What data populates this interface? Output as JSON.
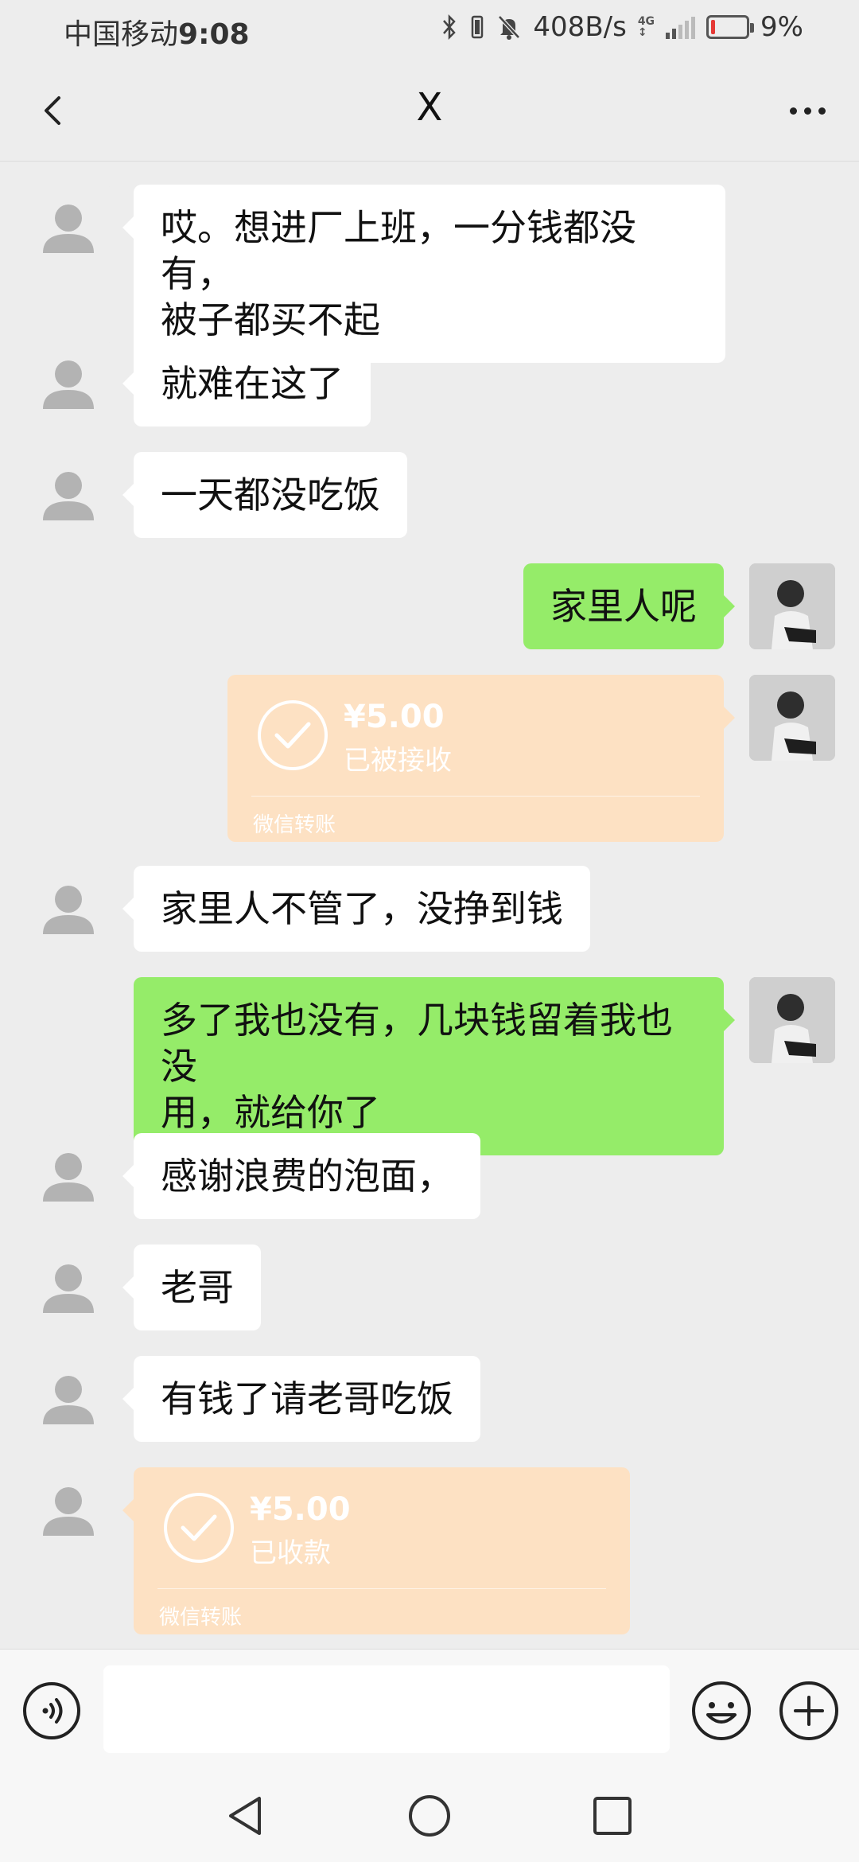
{
  "status_bar": {
    "carrier": "中国移动",
    "time": "9:08",
    "net_speed": "408B/s",
    "network_type": "4G",
    "battery_percent": "9%",
    "battery_level": 0.09
  },
  "header": {
    "back_icon": "chevron-left-icon",
    "title": "X",
    "more_icon": "more-dots-icon"
  },
  "messages": [
    {
      "side": "in",
      "type": "text",
      "text": "哎。想进厂上班，一分钱都没有，\n被子都买不起"
    },
    {
      "side": "in",
      "type": "text",
      "text": "就难在这了"
    },
    {
      "side": "in",
      "type": "text",
      "text": "一天都没吃饭"
    },
    {
      "side": "out",
      "type": "text",
      "text": "家里人呢"
    },
    {
      "side": "out",
      "type": "transfer",
      "amount": "¥5.00",
      "status": "已被接收",
      "label": "微信转账"
    },
    {
      "side": "in",
      "type": "text",
      "text": "家里人不管了，没挣到钱"
    },
    {
      "side": "out",
      "type": "text",
      "text": "多了我也没有，几块钱留着我也没\n用，就给你了"
    },
    {
      "side": "in",
      "type": "text",
      "text": "感谢浪费的泡面，"
    },
    {
      "side": "in",
      "type": "text",
      "text": "老哥"
    },
    {
      "side": "in",
      "type": "text",
      "text": "有钱了请老哥吃饭"
    },
    {
      "side": "in",
      "type": "transfer",
      "amount": "¥5.00",
      "status": "已收款",
      "label": "微信转账"
    }
  ],
  "input_bar": {
    "voice_icon": "voice-icon",
    "input_value": "",
    "emoji_icon": "emoji-icon",
    "plus_icon": "plus-icon"
  },
  "nav_bar": {
    "back_icon": "nav-back-icon",
    "home_icon": "nav-home-icon",
    "recents_icon": "nav-recents-icon"
  },
  "colors": {
    "background": "#ededed",
    "incoming_bubble": "#ffffff",
    "outgoing_bubble": "#95ec69",
    "transfer_card": "#fde1c3"
  }
}
